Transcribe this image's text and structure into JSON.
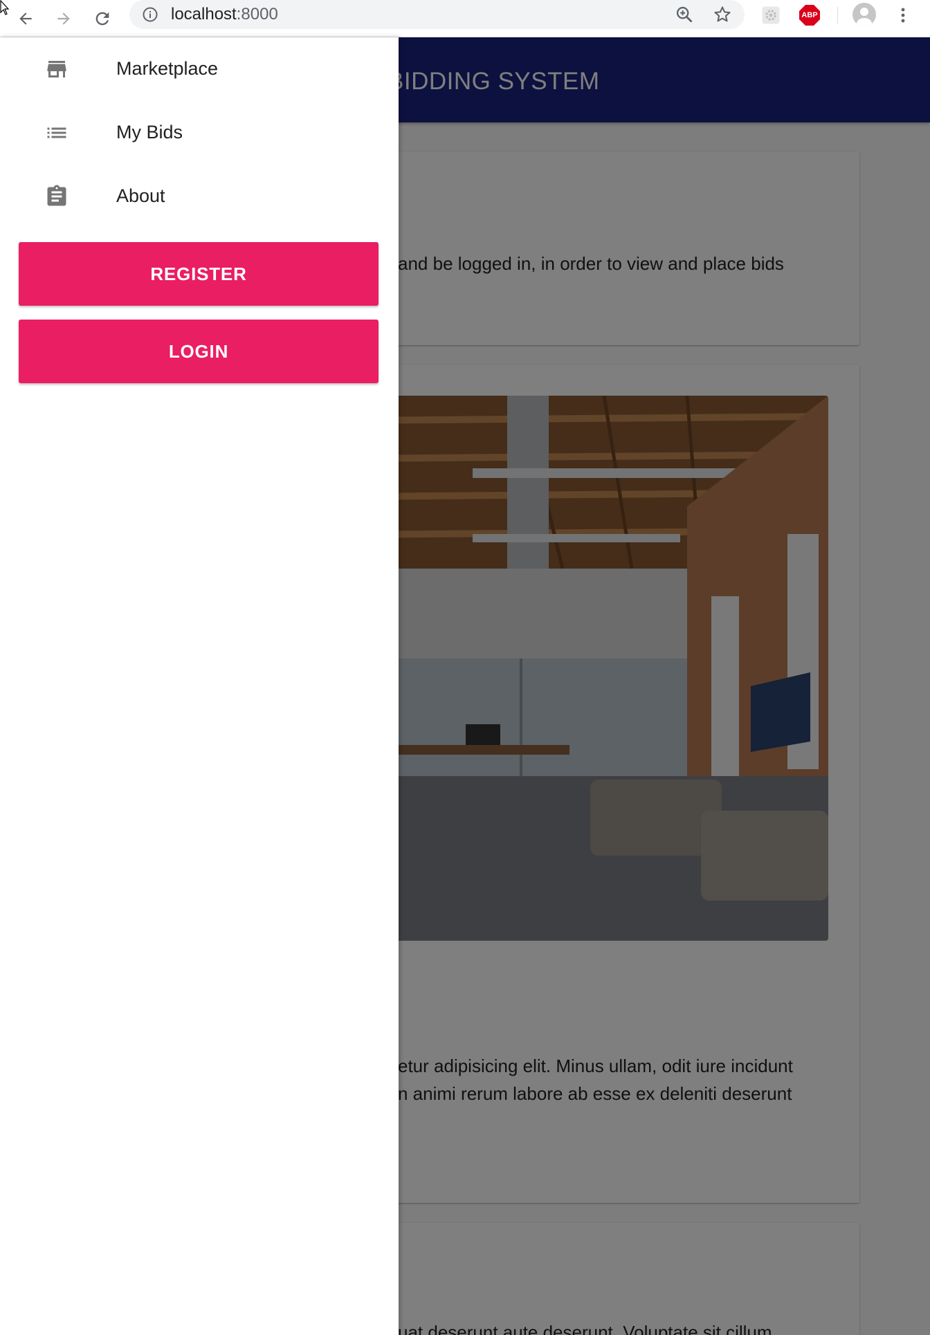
{
  "browser": {
    "url_host": "localhost",
    "url_port": ":8000",
    "extensions": [
      {
        "icon": "gear-extension-icon"
      },
      {
        "icon": "adblock-plus-icon",
        "label": "ABP"
      }
    ],
    "colors": {
      "abp_red": "#d9001b",
      "omnibox_bg": "#f1f3f4"
    }
  },
  "app": {
    "title_visible": "BIDDING SYSTEM",
    "colors": {
      "app_bar": "#1a237e",
      "accent": "#e91e63"
    }
  },
  "cards": {
    "notice_text": "and be logged in, in order to view and place bids",
    "about_line1": "etur adipisicing elit. Minus ullam, odit iure incidunt",
    "about_line2": "n animi rerum labore ab esse ex deleniti deserunt",
    "third_line1": "uat deserunt aute deserunt. Voluptate sit cillum"
  },
  "drawer": {
    "items": [
      {
        "label": "Marketplace",
        "icon": "store-icon"
      },
      {
        "label": "My Bids",
        "icon": "list-icon"
      },
      {
        "label": "About",
        "icon": "clipboard-icon"
      }
    ],
    "register_label": "REGISTER",
    "login_label": "LOGIN"
  }
}
